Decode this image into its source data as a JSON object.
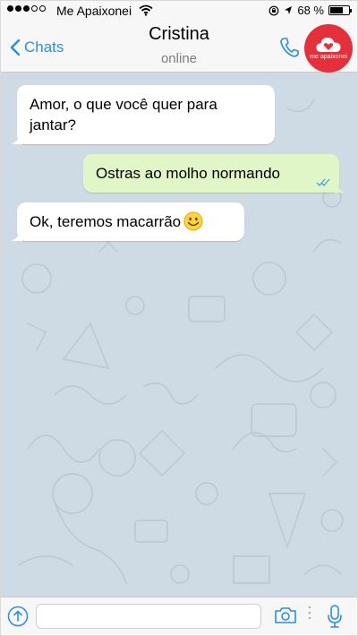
{
  "status_bar": {
    "carrier": "Me Apaixonei",
    "battery": "68 %",
    "battery_level": 0.68,
    "signal_strength": 3,
    "icons": [
      "signal-icon",
      "wifi-icon",
      "lock-rotation-icon",
      "location-icon",
      "battery-icon"
    ]
  },
  "header": {
    "back_label": "Chats",
    "contact_name": "Cristina",
    "contact_status": "online",
    "avatar_text": "me apaixonei",
    "icons": [
      "chevron-left-icon",
      "phone-icon"
    ]
  },
  "messages": [
    {
      "direction": "incoming",
      "text": "Amor, o que você quer para jantar?"
    },
    {
      "direction": "outgoing",
      "text": "Ostras ao molho normando",
      "read_ticks": "double-check-icon"
    },
    {
      "direction": "incoming",
      "text": "Ok, teremos macarrão",
      "emoji": "smiling-face-icon"
    }
  ],
  "input_bar": {
    "placeholder": "",
    "icons": [
      "attach-icon",
      "camera-icon",
      "microphone-icon"
    ]
  },
  "colors": {
    "accent": "#2a8fe0",
    "avatar_bg": "#e5303b",
    "chat_bg": "#cfdbe4",
    "outgoing_bubble": "#e0f6c6",
    "incoming_bubble": "#ffffff"
  }
}
